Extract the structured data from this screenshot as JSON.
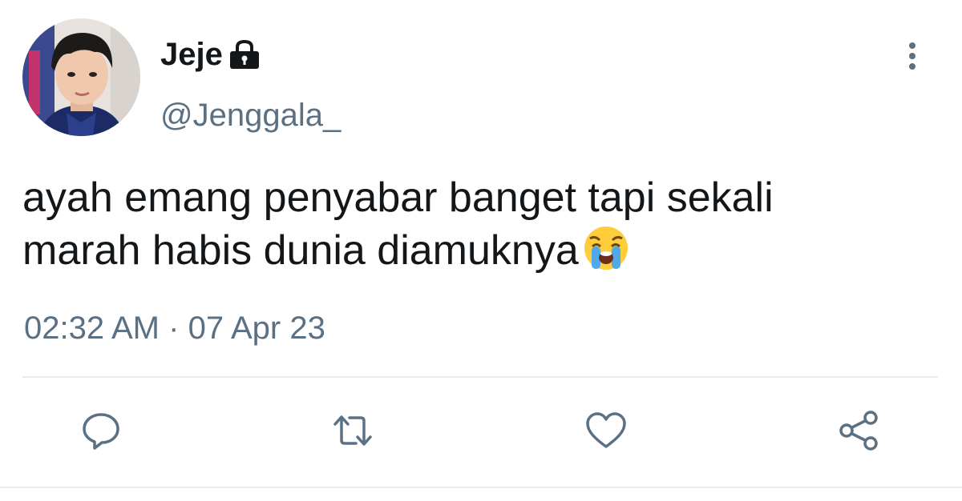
{
  "user": {
    "display_name": "Jeje",
    "handle": "@Jenggala_",
    "protected_icon": "lock-icon",
    "avatar": "profile-photo"
  },
  "tweet": {
    "lines": [
      "ayah emang penyabar banget tapi sekali",
      "marah habis dunia diamuknya"
    ],
    "emoji": "loudly-crying-face",
    "time": "02:32 AM",
    "separator": "·",
    "date": "07 Apr 23"
  },
  "actions": [
    {
      "icon": "reply-icon"
    },
    {
      "icon": "retweet-icon"
    },
    {
      "icon": "like-icon"
    },
    {
      "icon": "share-icon"
    }
  ],
  "menu_icon": "more-vertical-icon",
  "colors": {
    "text": "#14171a",
    "secondary": "#5b7083",
    "divider": "#e6ecf0"
  }
}
